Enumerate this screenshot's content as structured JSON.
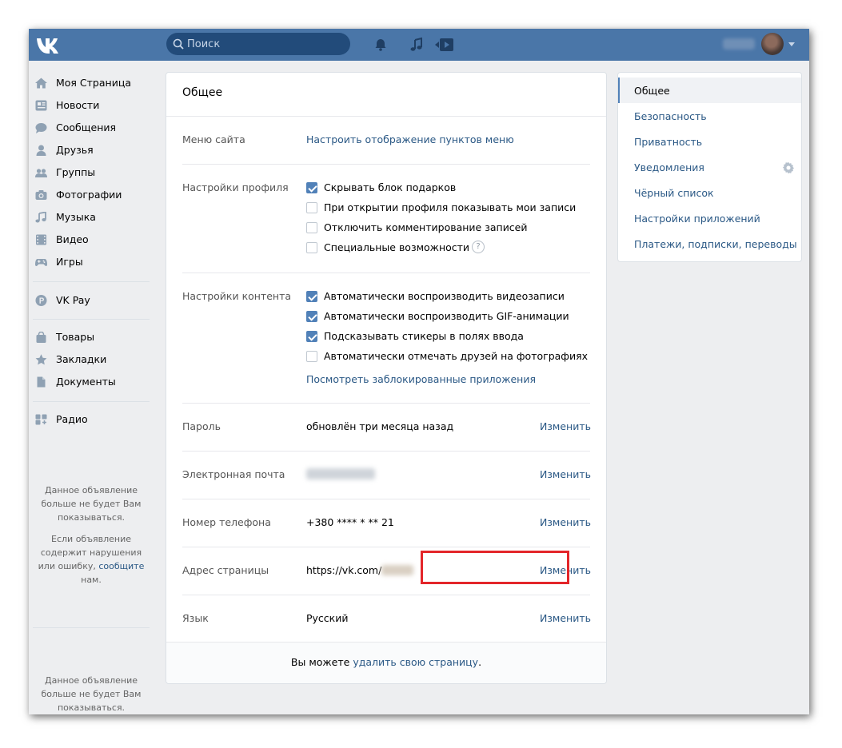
{
  "header": {
    "search_placeholder": "Поиск",
    "icons": [
      "vk-logo-icon",
      "search-icon",
      "bell-icon",
      "music-icon",
      "video-play-icon",
      "avatar"
    ]
  },
  "sidebar": {
    "items": [
      {
        "label": "Моя Страница",
        "icon": "home-icon"
      },
      {
        "label": "Новости",
        "icon": "news-icon"
      },
      {
        "label": "Сообщения",
        "icon": "messages-icon"
      },
      {
        "label": "Друзья",
        "icon": "friend-icon"
      },
      {
        "label": "Группы",
        "icon": "groups-icon"
      },
      {
        "label": "Фотографии",
        "icon": "camera-icon"
      },
      {
        "label": "Музыка",
        "icon": "music-icon"
      },
      {
        "label": "Видео",
        "icon": "film-icon"
      },
      {
        "label": "Игры",
        "icon": "gamepad-icon"
      },
      {
        "label": "VK Pay",
        "icon": "vkpay-icon"
      },
      {
        "label": "Товары",
        "icon": "bag-icon"
      },
      {
        "label": "Закладки",
        "icon": "star-icon"
      },
      {
        "label": "Документы",
        "icon": "document-icon"
      },
      {
        "label": "Радио",
        "icon": "apps-icon"
      }
    ],
    "ad1_line1": "Данное объявление больше не будет Вам показываться.",
    "ad1_line2_pre": "Если объявление содержит нарушения или ошибку,",
    "ad1_link": "сообщите",
    "ad1_line2_post": "нам.",
    "ad2": "Данное объявление больше не будет Вам показываться."
  },
  "main": {
    "title": "Общее",
    "menu_label": "Меню сайта",
    "menu_link": "Настроить отображение пунктов меню",
    "profile_label": "Настройки профиля",
    "profile_options": [
      {
        "text": "Скрывать блок подарков",
        "checked": true
      },
      {
        "text": "При открытии профиля показывать мои записи",
        "checked": false
      },
      {
        "text": "Отключить комментирование записей",
        "checked": false
      },
      {
        "text": "Специальные возможности",
        "checked": false
      }
    ],
    "help_mark": "?",
    "content_label": "Настройки контента",
    "content_options": [
      {
        "text": "Автоматически воспроизводить видеозаписи",
        "checked": true
      },
      {
        "text": "Автоматически воспроизводить GIF-анимации",
        "checked": true
      },
      {
        "text": "Подсказывать стикеры в полях ввода",
        "checked": true
      },
      {
        "text": "Автоматически отмечать друзей на фотографиях",
        "checked": false
      }
    ],
    "blocked_apps_link": "Посмотреть заблокированные приложения",
    "password_label": "Пароль",
    "password_value": "обновлён три месяца назад",
    "email_label": "Электронная почта",
    "phone_label": "Номер телефона",
    "phone_value": "+380 **** * ** 21",
    "address_label": "Адрес страницы",
    "address_value": "https://vk.com/",
    "language_label": "Язык",
    "language_value": "Русский",
    "change_label": "Изменить",
    "footer_pre": "Вы можете",
    "footer_link": "удалить свою страницу",
    "footer_post": ".",
    "highlight_color": "#e3262a"
  },
  "right_menu": {
    "items": [
      "Общее",
      "Безопасность",
      "Приватность",
      "Уведомления",
      "Чёрный список",
      "Настройки приложений",
      "Платежи, подписки, переводы"
    ],
    "active_index": 0
  },
  "colors": {
    "header_bg": "#4a76a8",
    "link": "#2a5885",
    "accent": "#5181b8",
    "page_bg": "#edeef0"
  }
}
